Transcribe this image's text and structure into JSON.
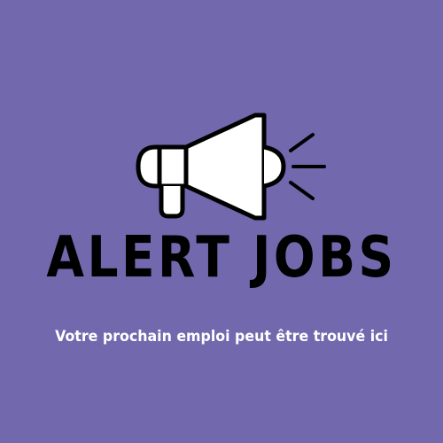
{
  "brand": {
    "title": "ALERT JOBS",
    "tagline": "Votre prochain emploi peut être trouvé ici"
  },
  "icons": {
    "logo": "megaphone-icon"
  },
  "colors": {
    "background": "#7268ae",
    "title": "#000000",
    "tagline": "#ffffff",
    "icon_stroke": "#000000",
    "icon_fill": "#ffffff"
  }
}
